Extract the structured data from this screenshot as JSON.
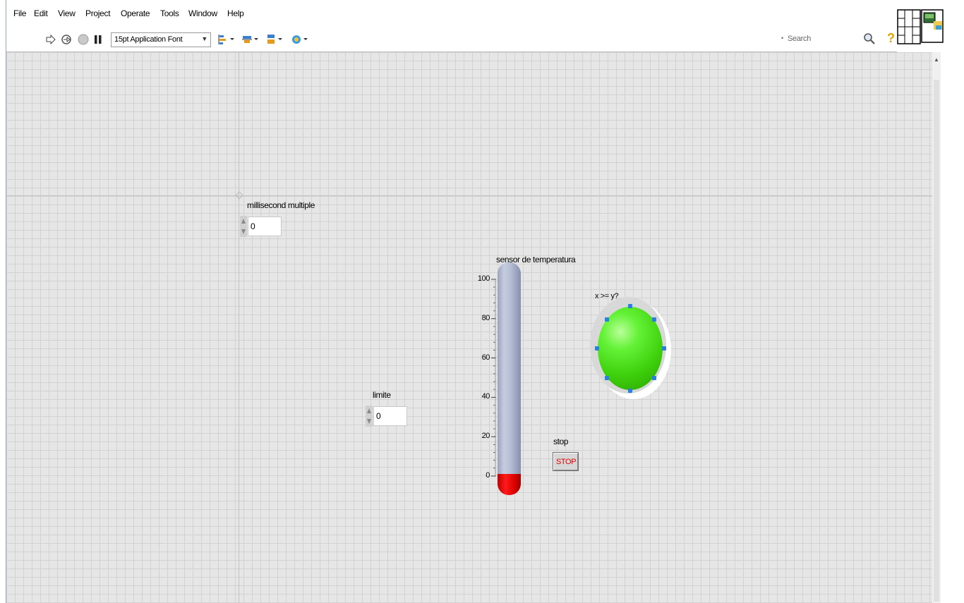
{
  "menubar": {
    "items": [
      {
        "label": "File"
      },
      {
        "label": "Edit"
      },
      {
        "label": "View"
      },
      {
        "label": "Project"
      },
      {
        "label": "Operate"
      },
      {
        "label": "Tools"
      },
      {
        "label": "Window"
      },
      {
        "label": "Help"
      }
    ]
  },
  "toolbar": {
    "run_icon": "run-arrow-icon",
    "run_continuously_icon": "run-continuously-icon",
    "abort_icon": "abort-icon",
    "pause_icon": "pause-icon",
    "font_select": {
      "value": "15pt Application Font"
    },
    "align_icon": "align-objects-icon",
    "distribute_icon": "distribute-objects-icon",
    "resize_icon": "resize-objects-icon",
    "reorder_icon": "reorder-icon",
    "search": {
      "placeholder": "Search"
    },
    "search_icon": "search-icon",
    "help_icon": "help-icon"
  },
  "front_panel": {
    "millisecond_control": {
      "label": "millisecond multiple",
      "value": "0"
    },
    "limite_control": {
      "label": "limite",
      "value": "0"
    },
    "thermometer": {
      "label": "sensor de temperatura",
      "ticks": [
        "100",
        "80",
        "60",
        "40",
        "20",
        "0"
      ],
      "range": [
        0,
        100
      ],
      "value": 0
    },
    "led": {
      "label": "x >= y?",
      "color": "#4fe01c",
      "state": "on"
    },
    "stop": {
      "label": "stop",
      "button_text": "STOP",
      "text_color": "#e00000"
    }
  }
}
